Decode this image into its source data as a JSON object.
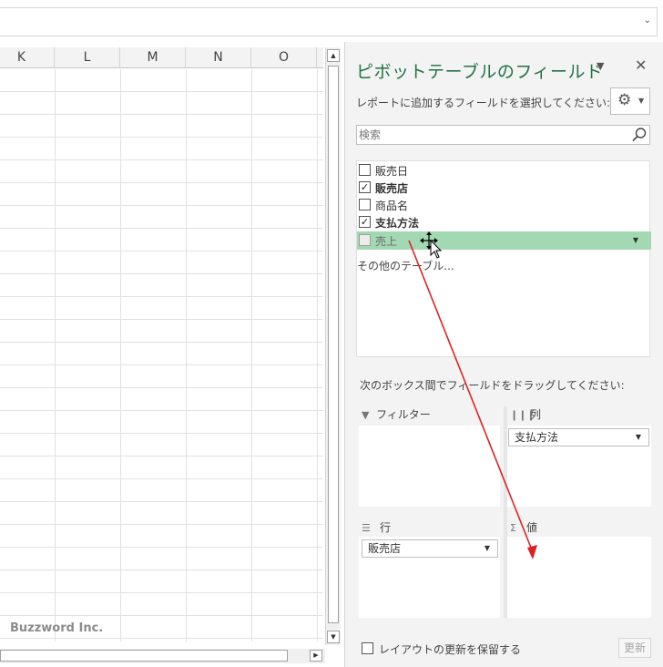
{
  "spreadsheet": {
    "columns": [
      "K",
      "L",
      "M",
      "N",
      "O"
    ],
    "watermark": "Buzzword Inc."
  },
  "pivot_pane": {
    "title": "ピボットテーブルのフィールド",
    "instruction": "レポートに追加するフィールドを選択してください:",
    "search_placeholder": "検索",
    "fields": [
      {
        "label": "販売日",
        "checked": false
      },
      {
        "label": "販売店",
        "checked": true
      },
      {
        "label": "商品名",
        "checked": false
      },
      {
        "label": "支払方法",
        "checked": true
      },
      {
        "label": "売上",
        "checked": false,
        "highlighted": true
      }
    ],
    "more_tables": "その他のテーブル...",
    "drag_instruction": "次のボックス間でフィールドをドラッグしてください:",
    "areas": {
      "filters": {
        "label": "フィルター",
        "fields": []
      },
      "columns": {
        "label": "列",
        "fields": [
          "支払方法"
        ]
      },
      "rows": {
        "label": "行",
        "fields": [
          "販売店"
        ]
      },
      "values": {
        "label": "値",
        "fields": []
      }
    },
    "defer_update_label": "レイアウトの更新を保留する",
    "update_button": "更新"
  },
  "colors": {
    "title_green": "#217346",
    "highlight_green": "#a2d9b3",
    "arrow_red": "#e02020"
  }
}
